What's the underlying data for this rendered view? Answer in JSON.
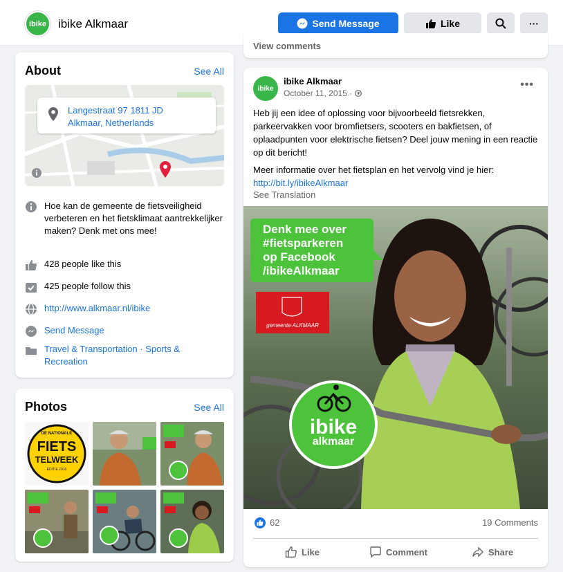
{
  "page": {
    "name": "ibike Alkmaar",
    "avatar_text": "ibike"
  },
  "header": {
    "send_message": "Send Message",
    "like": "Like",
    "more": "···"
  },
  "about": {
    "title": "About",
    "see_all": "See All",
    "address_line1": "Langestraat 97 1811 JD",
    "address_line2": "Alkmaar, Netherlands",
    "description": "Hoe kan de gemeente de fietsveiligheid verbeteren en het fietsklimaat aantrekkelijker maken? Denk met ons mee!",
    "likes": "428 people like this",
    "follows": "425 people follow this",
    "website": "http://www.alkmaar.nl/ibike",
    "send_message": "Send Message",
    "category_1": "Travel & Transportation",
    "category_sep": " · ",
    "category_2": "Sports &",
    "category_3": "Recreation"
  },
  "photos": {
    "title": "Photos",
    "see_all": "See All",
    "fiets_top": "DE NATIONALE",
    "fiets_main1": "FIETS",
    "fiets_main2": "TELWEEK",
    "fiets_bottom": "EDITIE 2016",
    "thumb_brand": "ibike"
  },
  "post_header": {
    "view_comments": "View comments"
  },
  "post": {
    "author": "ibike Alkmaar",
    "date": "October 11, 2015 ·",
    "dots": "•••",
    "text_1": "Heb jij een idee of oplossing voor bijvoorbeeld fietsrekken, parkeervakken voor bromfietsers, scooters en bakfietsen, of oplaadpunten voor elektrische fietsen? Deel jouw mening in een reactie op dit bericht!",
    "text_2": "Meer informatie over het fietsplan en het vervolg vind je hier:",
    "link": "http://bit.ly/ibikeAlkmaar",
    "see_translation": "See Translation",
    "image": {
      "bubble_line1": "Denk mee over",
      "bubble_line2": "#fietsparkeren",
      "bubble_line3": "op Facebook",
      "bubble_line4": "/ibikeAlkmaar",
      "gemeente": "gemeente ALKMAAR",
      "logo_word1": "ibike",
      "logo_word2": "alkmaar"
    },
    "reactions": "62",
    "comments": "19 Comments",
    "action_like": "Like",
    "action_comment": "Comment",
    "action_share": "Share"
  },
  "colors": {
    "brand_blue": "#1b74e4",
    "ibike_green": "#3ab54a",
    "bubble_green": "#4cc33b",
    "gemeente_red": "#d71920"
  }
}
